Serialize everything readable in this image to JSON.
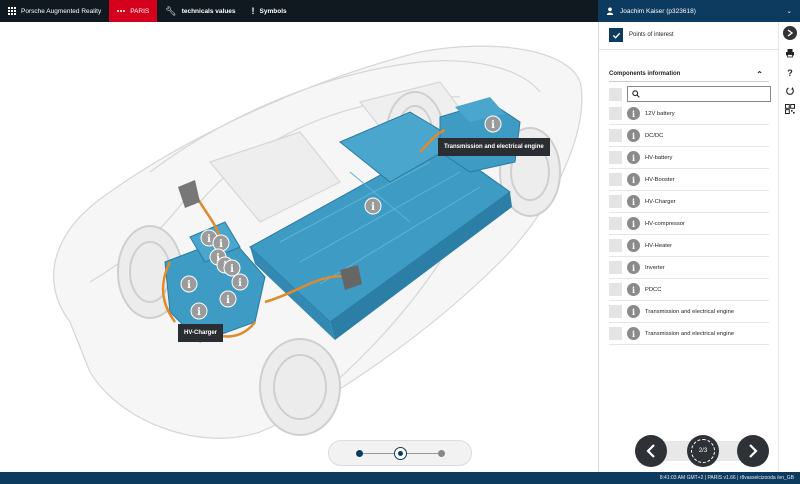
{
  "topbar": {
    "app_label": "Porsche Augmented Reality",
    "paris_label": "PARIS",
    "tech_label": "technicals values",
    "symbols_label": "Symbols",
    "user_label": "Joachim Kaiser (p323618)"
  },
  "scene": {
    "tooltip_engine": "Transmission and electrical engine",
    "tooltip_charger": "HV-Charger",
    "pager": {
      "pages": 3,
      "current": 2
    }
  },
  "panel": {
    "points_of_interest_label": "Points of interest",
    "points_of_interest_checked": true,
    "components_header": "Components information",
    "search_placeholder": "",
    "items": [
      {
        "label": "12V battery"
      },
      {
        "label": "DC/DC"
      },
      {
        "label": "HV-battery"
      },
      {
        "label": "HV-Booster"
      },
      {
        "label": "HV-Charger"
      },
      {
        "label": "HV-compressor"
      },
      {
        "label": "HV-Heater"
      },
      {
        "label": "Inverter"
      },
      {
        "label": "PDCC"
      },
      {
        "label": "Transmission and electrical engine"
      },
      {
        "label": "Transmission and electrical engine"
      }
    ],
    "nav_counter": "2/3"
  },
  "status": {
    "text": "8:41:03 AM GMT+2 | PARIS v1.66 | r8vasselcizooda /en_GB"
  },
  "colors": {
    "brand_red": "#d5001c",
    "navy": "#0d3a5f",
    "topbar": "#101820",
    "component_blue": "#3e9bc4",
    "cable_orange": "#e08a2b"
  }
}
